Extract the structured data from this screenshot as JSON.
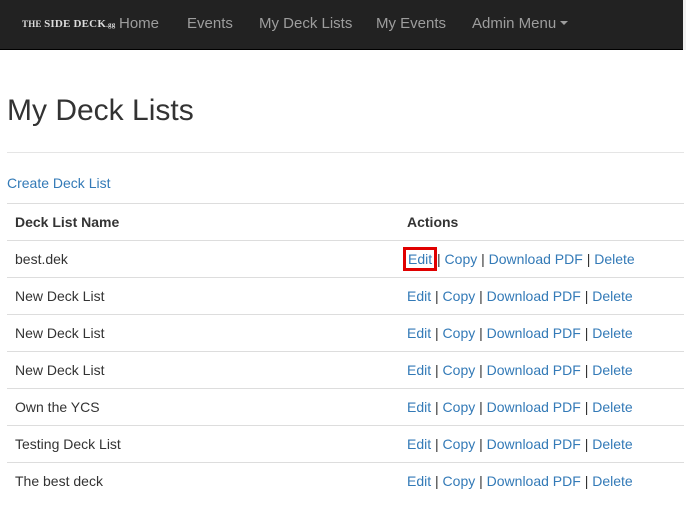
{
  "nav": {
    "brand_prefix": "THE",
    "brand_main": "SIDE DECK",
    "brand_suffix": ".gg",
    "items": [
      {
        "label": "Home"
      },
      {
        "label": "Events"
      },
      {
        "label": "My Deck Lists"
      },
      {
        "label": "My Events"
      },
      {
        "label": "Admin Menu"
      }
    ]
  },
  "page": {
    "title": "My Deck Lists",
    "create_link": "Create Deck List"
  },
  "table": {
    "headers": [
      "Deck List Name",
      "Actions"
    ],
    "actions": {
      "edit": "Edit",
      "copy": "Copy",
      "download": "Download PDF",
      "delete": "Delete",
      "separator": "|"
    },
    "rows": [
      {
        "name": "best.dek"
      },
      {
        "name": "New Deck List"
      },
      {
        "name": "New Deck List"
      },
      {
        "name": "New Deck List"
      },
      {
        "name": "Own the YCS"
      },
      {
        "name": "Testing Deck List"
      },
      {
        "name": "The best deck"
      }
    ]
  },
  "colors": {
    "navbar": "#222222",
    "link": "#337ab7",
    "highlight": "#e00000"
  }
}
